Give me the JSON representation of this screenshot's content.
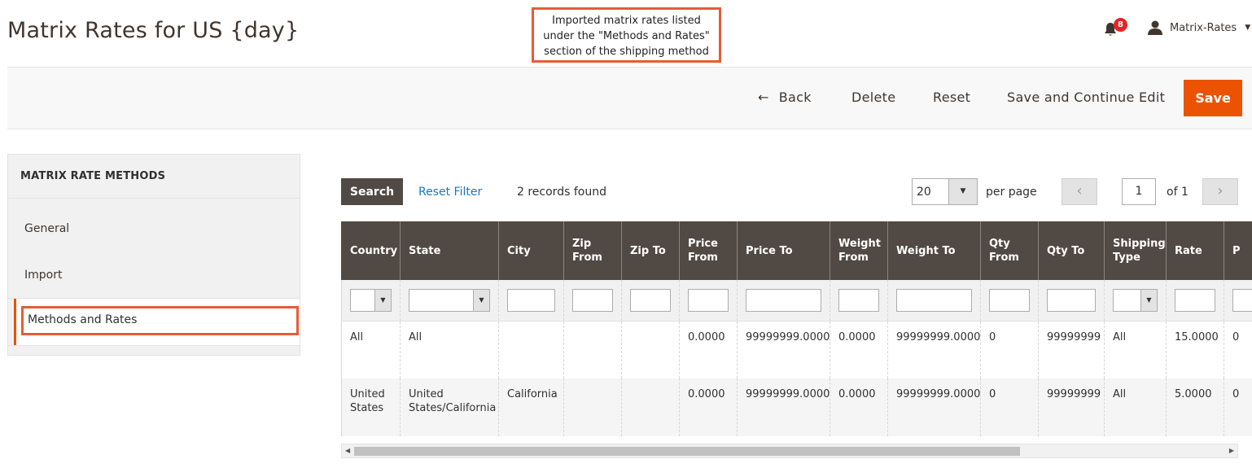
{
  "header": {
    "title": "Matrix Rates for US {day}",
    "notifications_count": "8",
    "user_name": "Matrix-Rates"
  },
  "annotation": {
    "line1": "Imported matrix rates listed",
    "line2": "under the \"Methods and Rates\"",
    "line3": "section of the shipping method"
  },
  "actions": {
    "back": "Back",
    "delete": "Delete",
    "reset": "Reset",
    "save_continue": "Save and Continue Edit",
    "save": "Save"
  },
  "sidebar": {
    "heading": "MATRIX RATE METHODS",
    "items": [
      {
        "label": "General"
      },
      {
        "label": "Import"
      },
      {
        "label": "Methods and Rates",
        "active": true
      }
    ]
  },
  "grid_toolbar": {
    "search": "Search",
    "reset_filter": "Reset Filter",
    "records": "2 records found",
    "per_page_value": "20",
    "per_page_label": "per page",
    "current_page": "1",
    "of_pages": "of 1"
  },
  "grid": {
    "columns": [
      "Country",
      "State",
      "City",
      "Zip From",
      "Zip To",
      "Price From",
      "Price To",
      "Weight From",
      "Weight To",
      "Qty From",
      "Qty To",
      "Shipping Type",
      "Rate",
      "P"
    ],
    "rows": [
      [
        "All",
        "All",
        "",
        "",
        "",
        "0.0000",
        "99999999.0000",
        "0.0000",
        "99999999.0000",
        "0",
        "99999999",
        "All",
        "15.0000",
        "0"
      ],
      [
        "United States",
        "United States/California",
        "California",
        "",
        "",
        "0.0000",
        "99999999.0000",
        "0.0000",
        "99999999.0000",
        "0",
        "99999999",
        "All",
        "5.0000",
        "0"
      ]
    ]
  },
  "colors": {
    "accent": "#eb5202",
    "header_bg": "#514943",
    "link": "#1979c3",
    "annotation_border": "#e45d35"
  }
}
